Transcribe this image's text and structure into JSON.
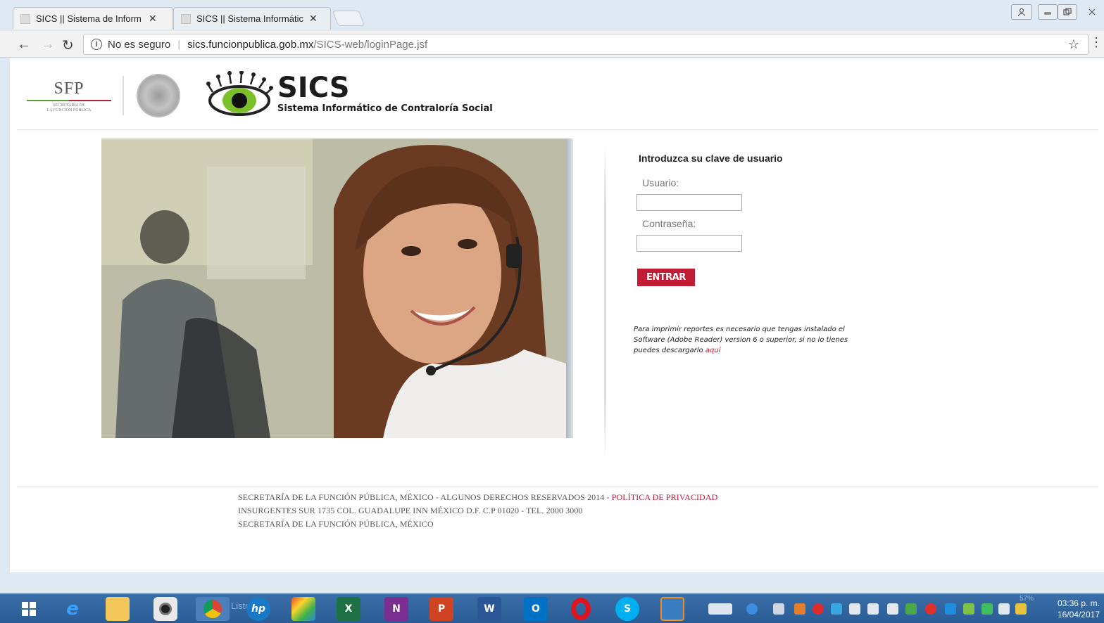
{
  "browser": {
    "tabs": [
      {
        "title": "SICS || Sistema de Inform",
        "active": true
      },
      {
        "title": "SICS || Sistema Informátic",
        "active": false
      }
    ],
    "close_glyph": "✕",
    "window_buttons": [
      "person-icon",
      "minimize-icon",
      "restore-icon",
      "close-icon"
    ],
    "address": {
      "security_label": "No es seguro",
      "host": "sics.funcionpublica.gob.mx",
      "path": "/SICS-web/loginPage.jsf"
    }
  },
  "header": {
    "sfp_abbrev": "SFP",
    "sfp_name_line1": "SECRETARÍA DE",
    "sfp_name_line2": "LA FUNCIÓN PÚBLICA",
    "app_title": "SICS",
    "app_subtitle": "Sistema Informático de Contraloría Social"
  },
  "login": {
    "heading": "Introduzca su clave de usuario",
    "user_label": "Usuario:",
    "user_value": "",
    "password_label": "Contraseña:",
    "password_value": "",
    "submit_label": "ENTRAR",
    "note_text": "Para imprimir reportes es necesario que tengas instalado el Software (Adobe Reader) version 6 o superior, si no lo tienes puedes descargarlo ",
    "note_link": "aquí"
  },
  "footer": {
    "line1": "Secretaría de la Función Pública, México - Algunos derechos reservados 2014 - ",
    "privacy_link": "Política de Privacidad",
    "line2": "Insurgentes Sur 1735 Col. Guadalupe Inn México D.F. C.P 01020 - Tel. 2000 3000",
    "line3": "Secretaría de la Función Pública, México"
  },
  "taskbar": {
    "items": [
      "windows-start-icon",
      "internet-explorer-icon",
      "file-explorer-icon",
      "camera-icon",
      "chrome-icon",
      "hp-icon",
      "paint-icon",
      "excel-icon",
      "onenote-icon",
      "powerpoint-icon",
      "word-icon",
      "outlook-icon",
      "opera-icon",
      "skype-icon",
      "media-player-icon"
    ],
    "item_letters": {
      "excel": "X",
      "onenote": "N",
      "powerpoint": "P",
      "word": "W",
      "outlook": "O",
      "skype": "S",
      "hp": "hp"
    },
    "search_ghost_text": "Listo",
    "battery_text": "57%",
    "time": "03:36 p. m.",
    "date": "16/04/2017"
  }
}
